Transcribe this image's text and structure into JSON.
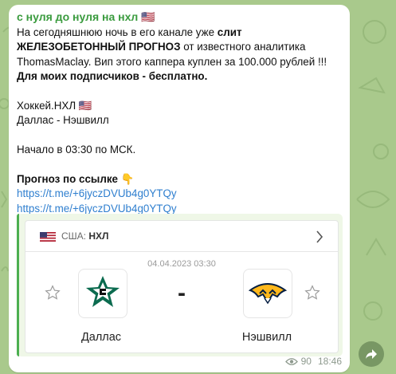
{
  "post": {
    "channel_name": "с нуля до нуля на нхл 🇺🇸",
    "p1_a": "На сегодняшнюю ночь в его канале уже ",
    "p1_b": "слит ЖЕЛЕЗОБЕТОННЫЙ ПРОГНОЗ",
    "p1_c": " от известного аналитика ThomasMaclay. Вип этого каппера куплен за 100.000 рублей !!!",
    "p2": "Для моих подписчиков - бесплатно.",
    "p3": "Хоккей.НХЛ 🇺🇸",
    "p4": "Даллас - Нэшвилл",
    "p5": "Начало в 03:30 по МСК.",
    "p6": "Прогноз по ссылке 👇",
    "link1": "https://t.me/+6jyczDVUb4g0YTQy",
    "link2": "https://t.me/+6jyczDVUb4g0YTQy"
  },
  "preview": {
    "country": "США:",
    "league": "НХЛ",
    "datetime": "04.04.2023 03:30",
    "score_separator": "-",
    "home_team": "Даллас",
    "away_team": "Нэшвилл"
  },
  "meta": {
    "views": "90",
    "time": "18:46"
  },
  "colors": {
    "wallpaper": "#a9c98c",
    "channel_name": "#3a9b3e",
    "link": "#2f7fcf",
    "preview_bar": "#4caf50",
    "preview_bg": "#eff7e7"
  },
  "icons": [
    "us-flag-icon",
    "chevron-right-icon",
    "star-icon",
    "dallas-stars-logo",
    "nashville-predators-logo",
    "eye-icon",
    "share-icon"
  ]
}
